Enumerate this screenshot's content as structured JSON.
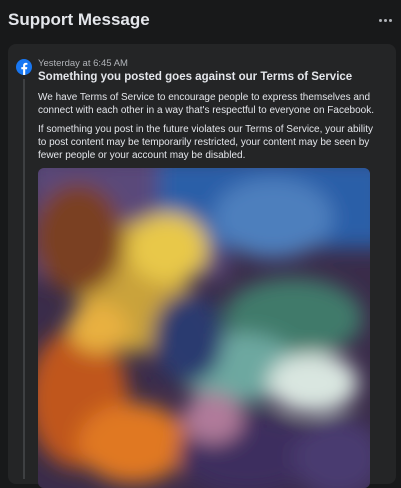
{
  "header": {
    "title": "Support Message",
    "more_icon": "more-horizontal-icon"
  },
  "message": {
    "sender_icon": "facebook-logo-icon",
    "timestamp": "Yesterday at 6:45 AM",
    "title": "Something you posted goes against our Terms of Service",
    "paragraph1": "We have Terms of Service to encourage people to express themselves and connect with each other in a way that's respectful to everyone on Facebook.",
    "paragraph2": "If something you post in the future violates our Terms of Service, your ability to post content may be temporarily restricted, your content may be seen by fewer people or your account may be disabled."
  },
  "colors": {
    "background": "#18191a",
    "card": "#242526",
    "text_primary": "#e4e6eb",
    "text_secondary": "#b0b3b8",
    "facebook_blue": "#1877f2"
  }
}
